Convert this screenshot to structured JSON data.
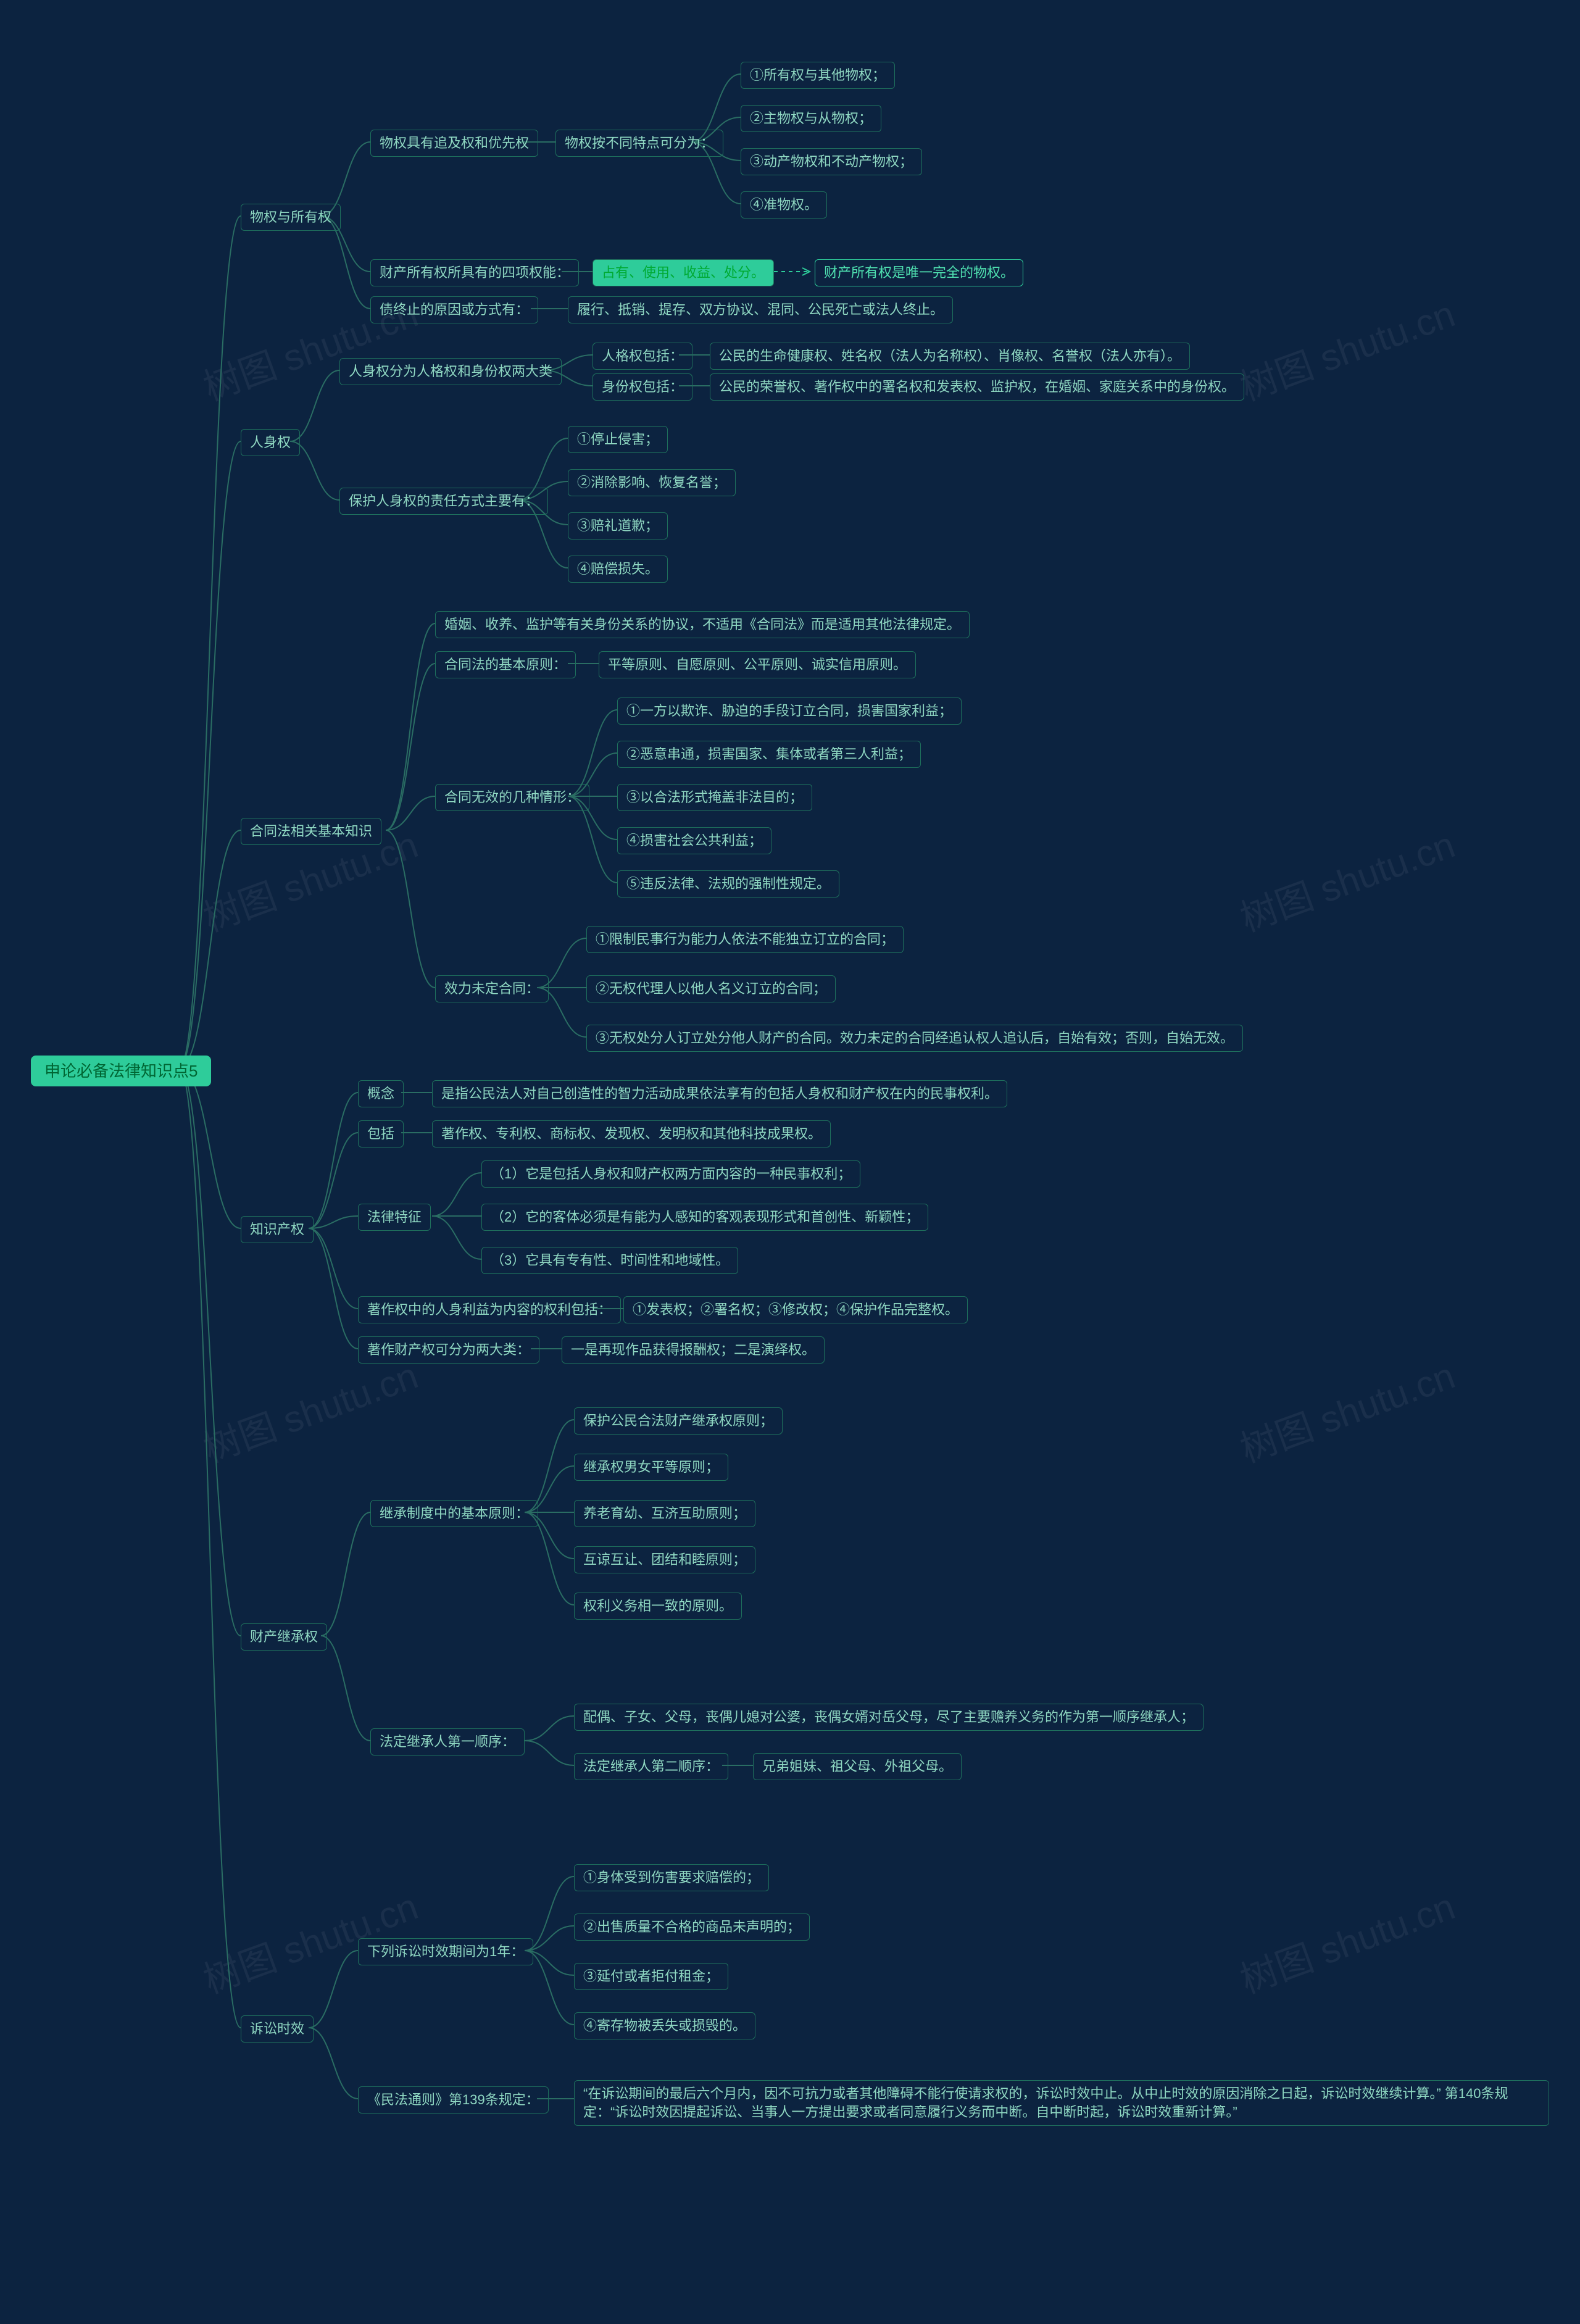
{
  "root": {
    "label": "申论必备法律知识点5"
  },
  "b1": {
    "label": "物权与所有权"
  },
  "b1_1": {
    "label": "物权具有追及权和优先权"
  },
  "b1_1a": {
    "label": "物权按不同特点可分为："
  },
  "b1_1a1": {
    "label": "①所有权与其他物权；"
  },
  "b1_1a2": {
    "label": "②主物权与从物权；"
  },
  "b1_1a3": {
    "label": "③动产物权和不动产物权；"
  },
  "b1_1a4": {
    "label": "④准物权。"
  },
  "b1_2": {
    "label": "财产所有权所具有的四项权能："
  },
  "b1_2a": {
    "label": "占有、使用、收益、处分。"
  },
  "b1_2b": {
    "label": "财产所有权是唯一完全的物权。"
  },
  "b1_3": {
    "label": "债终止的原因或方式有："
  },
  "b1_3a": {
    "label": "履行、抵销、提存、双方协议、混同、公民死亡或法人终止。"
  },
  "b2": {
    "label": "人身权"
  },
  "b2_1": {
    "label": "人身权分为人格权和身份权两大类"
  },
  "b2_1a": {
    "label": "人格权包括："
  },
  "b2_1a1": {
    "label": "公民的生命健康权、姓名权（法人为名称权）、肖像权、名誉权（法人亦有）。"
  },
  "b2_1b": {
    "label": "身份权包括："
  },
  "b2_1b1": {
    "label": "公民的荣誉权、著作权中的署名权和发表权、监护权，在婚姻、家庭关系中的身份权。"
  },
  "b2_2": {
    "label": "保护人身权的责任方式主要有："
  },
  "b2_2a": {
    "label": "①停止侵害；"
  },
  "b2_2b": {
    "label": "②消除影响、恢复名誉；"
  },
  "b2_2c": {
    "label": "③赔礼道歉；"
  },
  "b2_2d": {
    "label": "④赔偿损失。"
  },
  "b3": {
    "label": "合同法相关基本知识"
  },
  "b3_1": {
    "label": "婚姻、收养、监护等有关身份关系的协议，不适用《合同法》而是适用其他法律规定。"
  },
  "b3_2": {
    "label": "合同法的基本原则："
  },
  "b3_2a": {
    "label": "平等原则、自愿原则、公平原则、诚实信用原则。"
  },
  "b3_3": {
    "label": "合同无效的几种情形："
  },
  "b3_3a": {
    "label": "①一方以欺诈、胁迫的手段订立合同，损害国家利益；"
  },
  "b3_3b": {
    "label": "②恶意串通，损害国家、集体或者第三人利益；"
  },
  "b3_3c": {
    "label": "③以合法形式掩盖非法目的；"
  },
  "b3_3d": {
    "label": "④损害社会公共利益；"
  },
  "b3_3e": {
    "label": "⑤违反法律、法规的强制性规定。"
  },
  "b3_4": {
    "label": "效力未定合同："
  },
  "b3_4a": {
    "label": "①限制民事行为能力人依法不能独立订立的合同；"
  },
  "b3_4b": {
    "label": "②无权代理人以他人名义订立的合同；"
  },
  "b3_4c": {
    "label": "③无权处分人订立处分他人财产的合同。效力未定的合同经追认权人追认后，自始有效；否则，自始无效。"
  },
  "b4": {
    "label": "知识产权"
  },
  "b4_1": {
    "label": "概念"
  },
  "b4_1a": {
    "label": "是指公民法人对自己创造性的智力活动成果依法享有的包括人身权和财产权在内的民事权利。"
  },
  "b4_2": {
    "label": "包括"
  },
  "b4_2a": {
    "label": "著作权、专利权、商标权、发现权、发明权和其他科技成果权。"
  },
  "b4_3": {
    "label": "法律特征"
  },
  "b4_3a": {
    "label": "（1）它是包括人身权和财产权两方面内容的一种民事权利；"
  },
  "b4_3b": {
    "label": "（2）它的客体必须是有能为人感知的客观表现形式和首创性、新颖性；"
  },
  "b4_3c": {
    "label": "（3）它具有专有性、时间性和地域性。"
  },
  "b4_4": {
    "label": "著作权中的人身利益为内容的权利包括："
  },
  "b4_4a": {
    "label": "①发表权；②署名权；③修改权；④保护作品完整权。"
  },
  "b4_5": {
    "label": "著作财产权可分为两大类："
  },
  "b4_5a": {
    "label": "一是再现作品获得报酬权；二是演绎权。"
  },
  "b5": {
    "label": "财产继承权"
  },
  "b5_1": {
    "label": "继承制度中的基本原则："
  },
  "b5_1a": {
    "label": "保护公民合法财产继承权原则；"
  },
  "b5_1b": {
    "label": "继承权男女平等原则；"
  },
  "b5_1c": {
    "label": "养老育幼、互济互助原则；"
  },
  "b5_1d": {
    "label": "互谅互让、团结和睦原则；"
  },
  "b5_1e": {
    "label": "权利义务相一致的原则。"
  },
  "b5_2": {
    "label": "法定继承人第一顺序："
  },
  "b5_2a": {
    "label": "配偶、子女、父母，丧偶儿媳对公婆，丧偶女婿对岳父母，尽了主要赡养义务的作为第一顺序继承人；"
  },
  "b5_2b": {
    "label": "法定继承人第二顺序："
  },
  "b5_2b1": {
    "label": "兄弟姐妹、祖父母、外祖父母。"
  },
  "b6": {
    "label": "诉讼时效"
  },
  "b6_1": {
    "label": "下列诉讼时效期间为1年："
  },
  "b6_1a": {
    "label": "①身体受到伤害要求赔偿的；"
  },
  "b6_1b": {
    "label": "②出售质量不合格的商品未声明的；"
  },
  "b6_1c": {
    "label": "③延付或者拒付租金；"
  },
  "b6_1d": {
    "label": "④寄存物被丢失或损毁的。"
  },
  "b6_2": {
    "label": "《民法通则》第139条规定："
  },
  "b6_2a": {
    "label": "“在诉讼期间的最后六个月内，因不可抗力或者其他障碍不能行使请求权的，诉讼时效中止。从中止时效的原因消除之日起，诉讼时效继续计算。” 第140条规定：“诉讼时效因提起诉讼、当事人一方提出要求或者同意履行义务而中断。自中断时起，诉讼时效重新计算。”"
  },
  "watermark": "树图 shutu.cn"
}
